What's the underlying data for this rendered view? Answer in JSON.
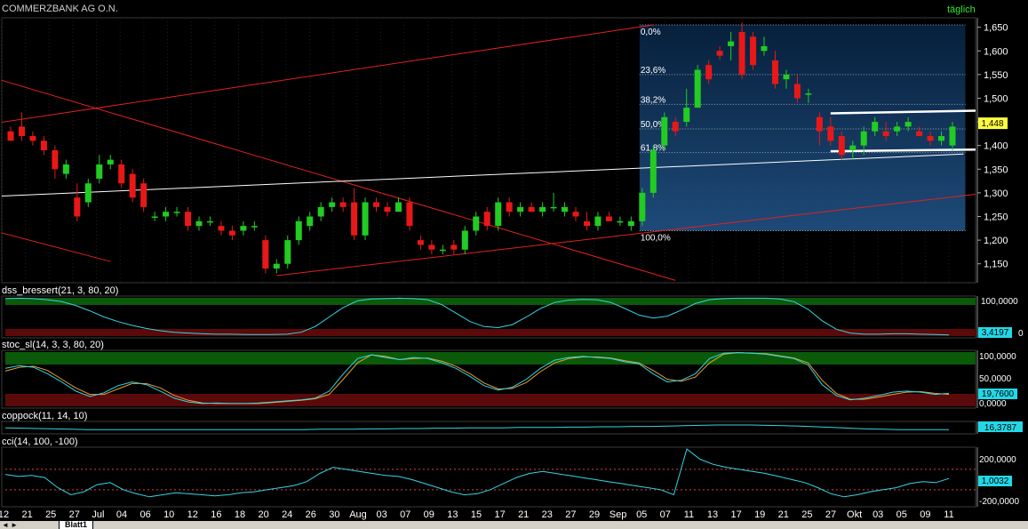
{
  "header": {
    "title": "COMMERZBANK AG O.N.",
    "frequency": "täglich"
  },
  "price_ticks": [
    "1,650",
    "1,600",
    "1,550",
    "1,500",
    "1,450",
    "1,400",
    "1,350",
    "1,300",
    "1,250",
    "1,200",
    "1,150"
  ],
  "price_label": "1,448",
  "fib_levels": [
    {
      "label": "0,0%",
      "value": 1.655
    },
    {
      "label": "23,6%",
      "value": 1.55
    },
    {
      "label": "38,2%",
      "value": 1.487
    },
    {
      "label": "50,0%",
      "value": 1.435
    },
    {
      "label": "61,8%",
      "value": 1.385
    },
    {
      "label": "100,0%",
      "value": 1.22
    }
  ],
  "x_labels": [
    "12",
    "21",
    "25",
    "27",
    "Jul",
    "04",
    "06",
    "10",
    "12",
    "16",
    "18",
    "20",
    "24",
    "26",
    "30",
    "Aug",
    "03",
    "07",
    "09",
    "13",
    "15",
    "17",
    "21",
    "23",
    "27",
    "29",
    "Sep",
    "05",
    "07",
    "11",
    "13",
    "17",
    "19",
    "21",
    "25",
    "27",
    "Okt",
    "03",
    "05",
    "09",
    "11"
  ],
  "panes": {
    "dss": {
      "label": "dss_bressert(21, 3, 80, 20)",
      "ticks": [
        "100,0000",
        "0"
      ],
      "value": "3,4197"
    },
    "stoc": {
      "label": "stoc_sl(14, 3, 3, 80, 20)",
      "ticks": [
        "100,0000",
        "50,0000",
        "0,0000"
      ],
      "value": "19,7600"
    },
    "coppock": {
      "label": "coppock(11, 14, 10)",
      "value": "16,3787"
    },
    "cci": {
      "label": "cci(14, 100, -100)",
      "ticks": [
        "200,0000",
        "0,0000",
        "-200,0000"
      ],
      "value": "1,0032"
    }
  },
  "tabs": {
    "sheet": "Blatt1"
  },
  "chart_data": [
    {
      "type": "candlestick",
      "title": "COMMERZBANK AG O.N.",
      "ylim": [
        1.11,
        1.67
      ],
      "candles": [
        [
          1.43,
          1.44,
          1.42,
          1.41
        ],
        [
          1.44,
          1.47,
          1.41,
          1.42
        ],
        [
          1.42,
          1.43,
          1.4,
          1.41
        ],
        [
          1.41,
          1.42,
          1.38,
          1.39
        ],
        [
          1.39,
          1.4,
          1.33,
          1.35
        ],
        [
          1.34,
          1.37,
          1.33,
          1.36
        ],
        [
          1.29,
          1.32,
          1.24,
          1.25
        ],
        [
          1.28,
          1.33,
          1.27,
          1.32
        ],
        [
          1.33,
          1.38,
          1.32,
          1.36
        ],
        [
          1.36,
          1.38,
          1.35,
          1.37
        ],
        [
          1.36,
          1.37,
          1.31,
          1.32
        ],
        [
          1.34,
          1.35,
          1.28,
          1.29
        ],
        [
          1.32,
          1.33,
          1.26,
          1.27
        ],
        [
          1.25,
          1.26,
          1.24,
          1.25
        ],
        [
          1.25,
          1.27,
          1.24,
          1.26
        ],
        [
          1.26,
          1.27,
          1.25,
          1.26
        ],
        [
          1.26,
          1.27,
          1.22,
          1.23
        ],
        [
          1.23,
          1.25,
          1.22,
          1.24
        ],
        [
          1.24,
          1.25,
          1.23,
          1.24
        ],
        [
          1.23,
          1.24,
          1.21,
          1.22
        ],
        [
          1.22,
          1.23,
          1.2,
          1.21
        ],
        [
          1.22,
          1.24,
          1.21,
          1.23
        ],
        [
          1.23,
          1.24,
          1.22,
          1.23
        ],
        [
          1.2,
          1.21,
          1.13,
          1.14
        ],
        [
          1.14,
          1.16,
          1.13,
          1.15
        ],
        [
          1.15,
          1.21,
          1.14,
          1.2
        ],
        [
          1.2,
          1.25,
          1.19,
          1.24
        ],
        [
          1.23,
          1.26,
          1.22,
          1.25
        ],
        [
          1.25,
          1.28,
          1.24,
          1.27
        ],
        [
          1.27,
          1.29,
          1.26,
          1.28
        ],
        [
          1.28,
          1.29,
          1.26,
          1.27
        ],
        [
          1.28,
          1.31,
          1.2,
          1.21
        ],
        [
          1.21,
          1.29,
          1.2,
          1.28
        ],
        [
          1.28,
          1.29,
          1.26,
          1.27
        ],
        [
          1.27,
          1.28,
          1.25,
          1.26
        ],
        [
          1.26,
          1.29,
          1.26,
          1.28
        ],
        [
          1.28,
          1.29,
          1.22,
          1.23
        ],
        [
          1.2,
          1.21,
          1.18,
          1.19
        ],
        [
          1.19,
          1.2,
          1.17,
          1.18
        ],
        [
          1.18,
          1.19,
          1.17,
          1.18
        ],
        [
          1.19,
          1.2,
          1.17,
          1.18
        ],
        [
          1.18,
          1.23,
          1.17,
          1.22
        ],
        [
          1.22,
          1.26,
          1.21,
          1.25
        ],
        [
          1.26,
          1.27,
          1.22,
          1.23
        ],
        [
          1.23,
          1.29,
          1.22,
          1.28
        ],
        [
          1.28,
          1.29,
          1.25,
          1.26
        ],
        [
          1.26,
          1.28,
          1.25,
          1.27
        ],
        [
          1.27,
          1.28,
          1.26,
          1.26
        ],
        [
          1.26,
          1.28,
          1.25,
          1.27
        ],
        [
          1.27,
          1.3,
          1.26,
          1.27
        ],
        [
          1.26,
          1.28,
          1.25,
          1.27
        ],
        [
          1.26,
          1.27,
          1.24,
          1.25
        ],
        [
          1.24,
          1.26,
          1.22,
          1.23
        ],
        [
          1.23,
          1.26,
          1.22,
          1.25
        ],
        [
          1.25,
          1.26,
          1.24,
          1.24
        ],
        [
          1.24,
          1.25,
          1.23,
          1.24
        ],
        [
          1.23,
          1.25,
          1.22,
          1.24
        ],
        [
          1.24,
          1.31,
          1.23,
          1.3
        ],
        [
          1.3,
          1.4,
          1.29,
          1.39
        ],
        [
          1.4,
          1.47,
          1.39,
          1.46
        ],
        [
          1.45,
          1.46,
          1.42,
          1.43
        ],
        [
          1.45,
          1.52,
          1.44,
          1.48
        ],
        [
          1.48,
          1.57,
          1.48,
          1.56
        ],
        [
          1.57,
          1.58,
          1.53,
          1.54
        ],
        [
          1.6,
          1.61,
          1.58,
          1.59
        ],
        [
          1.61,
          1.64,
          1.58,
          1.62
        ],
        [
          1.64,
          1.66,
          1.54,
          1.55
        ],
        [
          1.63,
          1.64,
          1.56,
          1.57
        ],
        [
          1.6,
          1.63,
          1.59,
          1.61
        ],
        [
          1.58,
          1.6,
          1.52,
          1.53
        ],
        [
          1.54,
          1.56,
          1.52,
          1.55
        ],
        [
          1.53,
          1.55,
          1.49,
          1.5
        ],
        [
          1.51,
          1.52,
          1.49,
          1.51
        ],
        [
          1.46,
          1.47,
          1.4,
          1.43
        ],
        [
          1.44,
          1.46,
          1.4,
          1.41
        ],
        [
          1.42,
          1.43,
          1.37,
          1.38
        ],
        [
          1.39,
          1.41,
          1.37,
          1.4
        ],
        [
          1.4,
          1.44,
          1.38,
          1.43
        ],
        [
          1.43,
          1.46,
          1.42,
          1.45
        ],
        [
          1.43,
          1.45,
          1.41,
          1.42
        ],
        [
          1.43,
          1.45,
          1.42,
          1.44
        ],
        [
          1.44,
          1.46,
          1.43,
          1.45
        ],
        [
          1.43,
          1.44,
          1.42,
          1.42
        ],
        [
          1.42,
          1.43,
          1.4,
          1.41
        ],
        [
          1.41,
          1.43,
          1.4,
          1.42
        ],
        [
          1.4,
          1.45,
          1.39,
          1.44
        ]
      ],
      "fib_box": {
        "x_start": 57,
        "x_end": 86,
        "top": 1.655,
        "bottom": 1.22
      },
      "trendlines": [
        {
          "name": "upper-channel",
          "color": "#e02020",
          "p1": [
            -4,
            1.438
          ],
          "p2": [
            58,
            1.655
          ]
        },
        {
          "name": "lower-channel",
          "color": "#e02020",
          "p1": [
            24,
            1.125
          ],
          "p2": [
            90,
            1.305
          ]
        },
        {
          "name": "falling-line",
          "color": "#e02020",
          "p1": [
            -4,
            1.56
          ],
          "p2": [
            60,
            1.115
          ]
        },
        {
          "name": "falling-line-2",
          "color": "#e02020",
          "p1": [
            -4,
            1.235
          ],
          "p2": [
            9,
            1.155
          ]
        },
        {
          "name": "support",
          "color": "#ffffff",
          "p1": [
            -4,
            1.29
          ],
          "p2": [
            86,
            1.382
          ]
        },
        {
          "name": "range-top",
          "color": "#ffffff",
          "p1": [
            74,
            1.468
          ],
          "p2": [
            88,
            1.474
          ]
        },
        {
          "name": "range-bottom",
          "color": "#ffffff",
          "p1": [
            74,
            1.388
          ],
          "p2": [
            89,
            1.392
          ]
        }
      ]
    },
    {
      "type": "line",
      "name_label": "dss_bressert(21, 3, 80, 20)",
      "ylim": [
        0,
        100
      ],
      "series": [
        {
          "color": "#33d6e6",
          "values": [
            98,
            99,
            98,
            95,
            90,
            80,
            66,
            50,
            38,
            28,
            20,
            14,
            10,
            8,
            6,
            5,
            5,
            4,
            4,
            4,
            5,
            10,
            25,
            50,
            75,
            92,
            97,
            98,
            99,
            98,
            95,
            82,
            60,
            38,
            25,
            22,
            30,
            50,
            72,
            88,
            94,
            96,
            95,
            88,
            72,
            55,
            47,
            52,
            68,
            85,
            95,
            98,
            99,
            99,
            99,
            97,
            90,
            70,
            40,
            18,
            8,
            5,
            5,
            6,
            6,
            5,
            4,
            3
          ]
        }
      ]
    },
    {
      "type": "line",
      "name_label": "stoc_sl(14, 3, 3, 80, 20)",
      "ylim": [
        0,
        100
      ],
      "series": [
        {
          "color": "#33d6e6",
          "values": [
            70,
            75,
            72,
            60,
            45,
            28,
            18,
            25,
            38,
            45,
            40,
            28,
            15,
            8,
            5,
            6,
            5,
            5,
            6,
            8,
            10,
            12,
            15,
            28,
            60,
            88,
            95,
            90,
            86,
            90,
            88,
            80,
            70,
            55,
            38,
            30,
            35,
            50,
            70,
            85,
            90,
            92,
            90,
            88,
            82,
            78,
            60,
            45,
            48,
            60,
            88,
            98,
            99,
            98,
            96,
            92,
            88,
            76,
            40,
            20,
            12,
            15,
            20,
            26,
            28,
            26,
            22,
            24
          ]
        },
        {
          "color": "#e6a030",
          "values": [
            65,
            72,
            74,
            66,
            50,
            34,
            22,
            22,
            32,
            42,
            42,
            34,
            20,
            11,
            6,
            5,
            5,
            5,
            5,
            7,
            9,
            11,
            14,
            22,
            50,
            80,
            95,
            92,
            86,
            88,
            89,
            83,
            74,
            60,
            43,
            32,
            33,
            44,
            64,
            80,
            88,
            91,
            91,
            89,
            84,
            80,
            66,
            50,
            46,
            54,
            80,
            96,
            99,
            98,
            97,
            93,
            89,
            80,
            48,
            24,
            13,
            13,
            17,
            22,
            26,
            27,
            24,
            22
          ]
        }
      ]
    },
    {
      "type": "line",
      "name_label": "coppock(11, 14, 10)",
      "series": [
        {
          "color": "#33d6e6",
          "values": [
            52,
            51,
            50,
            49,
            48,
            47,
            47,
            47,
            47,
            47,
            47,
            47,
            47,
            47,
            47,
            47,
            47,
            47,
            47,
            48,
            48,
            48,
            49,
            49,
            50,
            50,
            51,
            51,
            52,
            52,
            52,
            53,
            53,
            53,
            54,
            54,
            55,
            55,
            56,
            56,
            57,
            58,
            59,
            60,
            60,
            60,
            59,
            58,
            57,
            55,
            53,
            51,
            49,
            48,
            47,
            47,
            47,
            47
          ]
        }
      ]
    },
    {
      "type": "line",
      "name_label": "cci(14, 100, -100)",
      "ylim": [
        -250,
        300
      ],
      "series": [
        {
          "color": "#33d6e6",
          "values": [
            50,
            30,
            40,
            20,
            -80,
            -150,
            -120,
            -50,
            -30,
            -100,
            -140,
            -170,
            -150,
            -130,
            -140,
            -150,
            -160,
            -150,
            -130,
            -120,
            -100,
            -80,
            -60,
            -20,
            60,
            120,
            100,
            80,
            60,
            40,
            30,
            0,
            -40,
            -80,
            -120,
            -150,
            -140,
            -100,
            -40,
            20,
            60,
            80,
            60,
            40,
            20,
            0,
            -20,
            -40,
            -60,
            -80,
            -100,
            -150,
            300,
            200,
            150,
            120,
            100,
            80,
            60,
            30,
            0,
            -30,
            -80,
            -140,
            -170,
            -150,
            -120,
            -100,
            -80,
            -40,
            -20,
            -30,
            10
          ]
        }
      ]
    }
  ]
}
